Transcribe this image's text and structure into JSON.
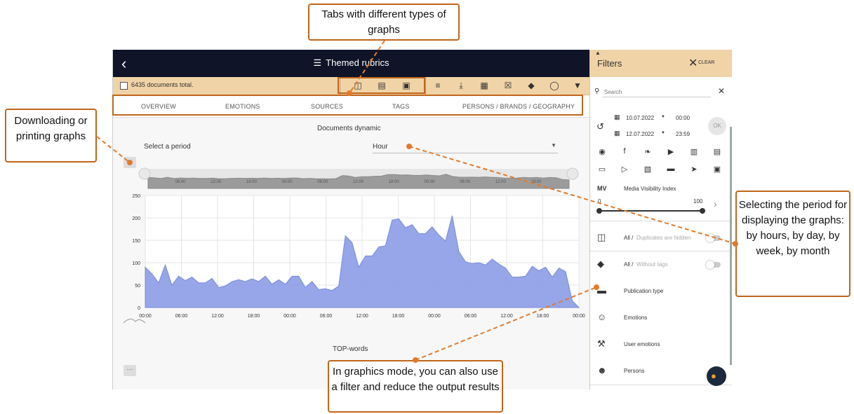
{
  "app": {
    "title": "Themed rubrics",
    "back_icon": "chevron-left-icon",
    "title_icon": "list-icon"
  },
  "toolbar": {
    "total": "6435 documents total.",
    "icons": [
      "file-icon",
      "bar-chart-icon",
      "image-icon",
      "lines-icon",
      "download-icon",
      "save-icon",
      "delete-icon",
      "tag-icon",
      "speech-bubble-icon",
      "filter-icon"
    ]
  },
  "tabs": [
    "OVERVIEW",
    "EMOTIONS",
    "SOURCES",
    "TAGS",
    "PERSONS / BRANDS / GEOGRAPHY"
  ],
  "main": {
    "chart_title": "Documents dynamic",
    "period_label": "Select a period",
    "period_value": "Hour",
    "dots": "···",
    "topwords_title": "TOP-words"
  },
  "navigator": {
    "ticks": [
      "06:00",
      "12:00",
      "18:00",
      "00:00",
      "06:00",
      "12:00",
      "18:00",
      "00:00",
      "06:00",
      "12:00",
      "18:00"
    ]
  },
  "chart_data": {
    "type": "area",
    "color": "#8c9ce6",
    "ylim": [
      0,
      250
    ],
    "yticks": [
      "250",
      "200",
      "150",
      "100",
      "50",
      "0"
    ],
    "xticks": [
      "00:00",
      "06:00",
      "12:00",
      "18:00",
      "00:00",
      "06:00",
      "12:00",
      "18:00",
      "00:00",
      "06:00",
      "12:00",
      "18:00",
      "00:00"
    ],
    "values": [
      90,
      75,
      55,
      95,
      50,
      70,
      60,
      68,
      55,
      55,
      65,
      45,
      48,
      58,
      62,
      58,
      64,
      58,
      70,
      52,
      62,
      52,
      70,
      70,
      45,
      58,
      40,
      42,
      38,
      48,
      160,
      145,
      90,
      115,
      115,
      135,
      138,
      195,
      198,
      178,
      185,
      165,
      165,
      180,
      162,
      148,
      205,
      125,
      102,
      98,
      100,
      95,
      108,
      97,
      88,
      68,
      68,
      70,
      92,
      82,
      90,
      68,
      88,
      80,
      15,
      0
    ]
  },
  "filters": {
    "title": "Filters",
    "clear_label": "CLEAR",
    "search_placeholder": "Search",
    "date_from": "10.07.2022",
    "time_from": "00:00",
    "date_to": "12.07.2022",
    "time_to": "23:59",
    "ok_label": "OK",
    "mvi_abbr": "MV",
    "mvi_label": "Media Visibility Index",
    "mvi_min": "0",
    "mvi_max": "100",
    "duplicates_all": "All /",
    "duplicates_hidden": "Duplicates are hidden",
    "tags_all": "All /",
    "tags_without": "Without tags",
    "publication_type": "Publication type",
    "emotions": "Emotions",
    "user_emotions": "User emotions",
    "persons": "Persons",
    "source_icons_row1": [
      "globe-icon",
      "facebook-icon",
      "twitter-icon",
      "youtube-icon",
      "contact-icon",
      "newspaper-icon"
    ],
    "source_icons_row2": [
      "tv-icon",
      "video-icon",
      "radio-icon",
      "forum-icon",
      "telegram-icon",
      "instagram-icon"
    ]
  },
  "callouts": {
    "tabs": "Tabs with different types of graphs",
    "download": "Downloading or printing graphs",
    "period": "Selecting the period for displaying the graphs: by hours, by day, by week, by month",
    "filter": "In graphics mode, you can also use a filter and reduce the output results"
  },
  "colors": {
    "topbar": "#0f1428",
    "toolbar": "#f0d3a7",
    "accent": "#c0661c",
    "area": "#8c9ce6"
  }
}
